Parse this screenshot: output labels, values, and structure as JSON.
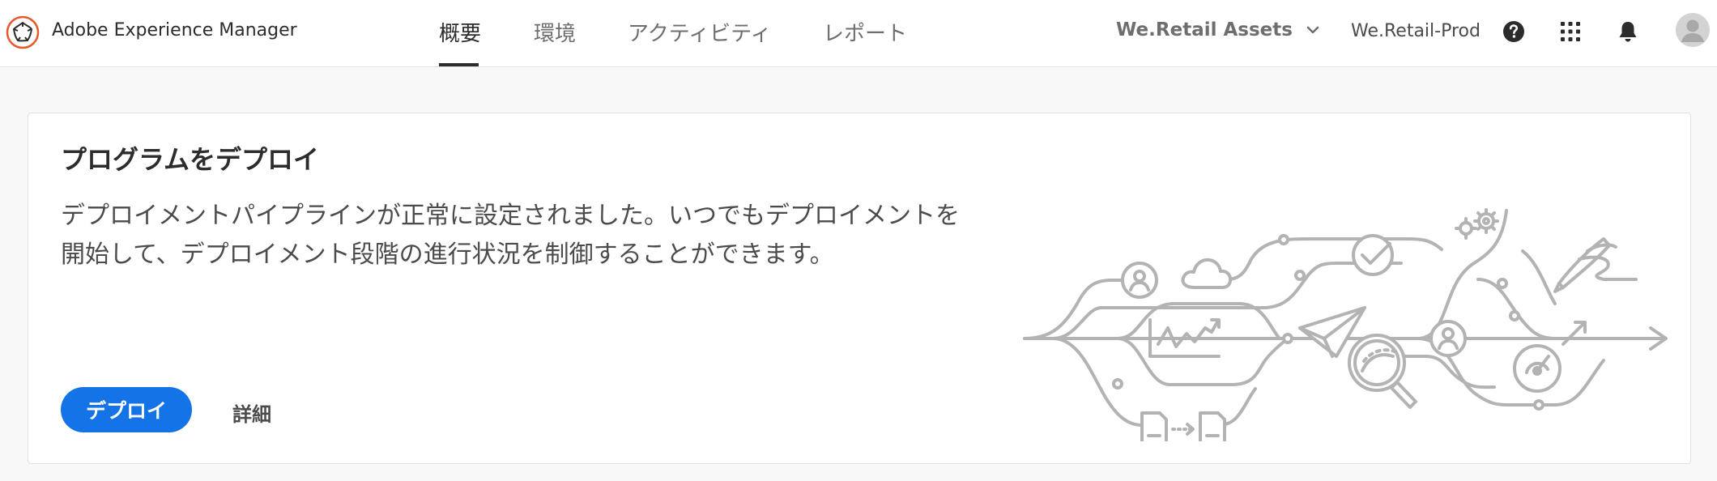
{
  "app": {
    "name": "Adobe Experience Manager"
  },
  "nav": {
    "tabs": [
      {
        "label": "概要",
        "active": true
      },
      {
        "label": "環境",
        "active": false
      },
      {
        "label": "アクティビティ",
        "active": false
      },
      {
        "label": "レポート",
        "active": false
      }
    ]
  },
  "header": {
    "org_switch_label": "We.Retail Assets",
    "program_name": "We.Retail-Prod",
    "icons": [
      "help-icon",
      "app-grid-icon",
      "bell-icon",
      "avatar"
    ]
  },
  "card": {
    "title": "プログラムをデプロイ",
    "description": "デプロイメントパイプラインが正常に設定されました。いつでもデプロイメントを開始して、デプロイメント段階の進行状況を制御することができます。",
    "primary_button": "デプロイ",
    "secondary_button": "詳細"
  },
  "colors": {
    "accent": "#1473e6",
    "brand_ring": "#e8582a",
    "illustration_stroke": "#b3b3b3"
  }
}
